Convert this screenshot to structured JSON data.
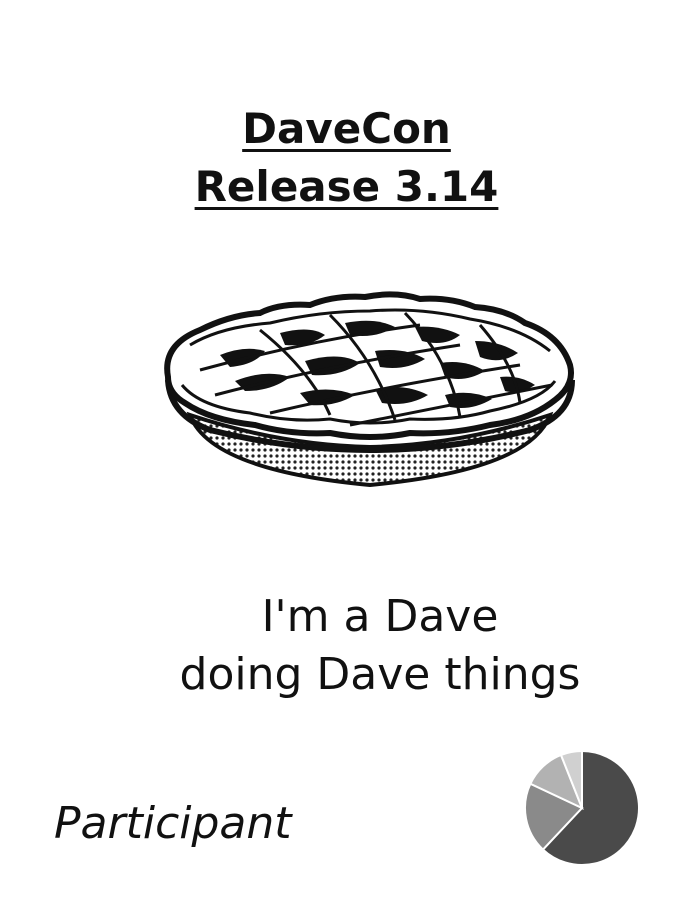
{
  "header": {
    "line1": "DaveCon",
    "line2": "Release 3.14"
  },
  "illustration": {
    "icon": "lattice-pie-icon"
  },
  "tagline": {
    "line1": "I'm a Dave",
    "line2": "doing Dave things"
  },
  "role": {
    "label": "Participant"
  },
  "chart_data": {
    "type": "pie",
    "values": [
      62,
      20,
      12,
      6
    ],
    "colors": [
      "#4a4a4a",
      "#8a8a8a",
      "#b2b2b2",
      "#d0d0d0"
    ]
  }
}
